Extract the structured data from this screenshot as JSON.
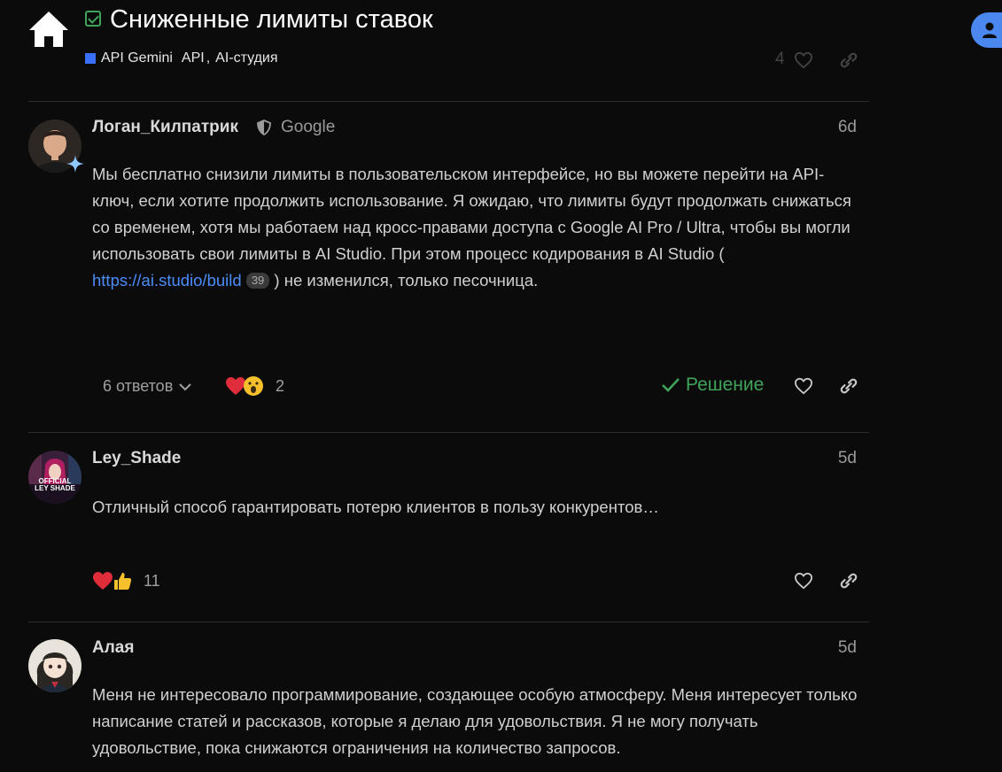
{
  "header": {
    "title": "Сниженные лимиты ставок",
    "categories": [
      "API Gemini",
      "API",
      ",",
      "AI-студия"
    ],
    "like_count": "4",
    "colors": {
      "accent": "#4a88f0",
      "check": "#3fa35a",
      "category": "#3a6ff7"
    }
  },
  "posts": [
    {
      "username": "Логан_Килпатрик",
      "group": "Google",
      "date": "6d",
      "body_before_link": "Мы бесплатно снизили лимиты в пользовательском интерфейсе, но вы можете перейти на API-ключ, если хотите продолжить использование. Я ожидаю, что лимиты будут продолжать снижаться со временем, хотя мы работаем над кросс-правами доступа с Google AI Pro / Ultra, чтобы вы могли использовать свои лимиты в AI Studio. При этом процесс кодирования в AI Studio ( ",
      "link": "https://ai.studio/build",
      "link_clicks": "39",
      "body_after_link": " ) не изменился, только песочница.",
      "replies": "6 ответов",
      "reactions_count": "2",
      "solution_label": "Решение"
    },
    {
      "username": "Ley_Shade",
      "date": "5d",
      "avatar_text": "OFFICIAL LEY SHADE",
      "body": "Отличный способ гарантировать потерю клиентов в пользу конкурентов…",
      "reactions_count": "11"
    },
    {
      "username": "Алая",
      "date": "5d",
      "body": "Меня не интересовало программирование, создающее особую атмосферу. Меня интересует только написание статей и рассказов, которые я делаю для удовольствия. Я не могу получать удовольствие, пока снижаются ограничения на количество запросов."
    }
  ]
}
